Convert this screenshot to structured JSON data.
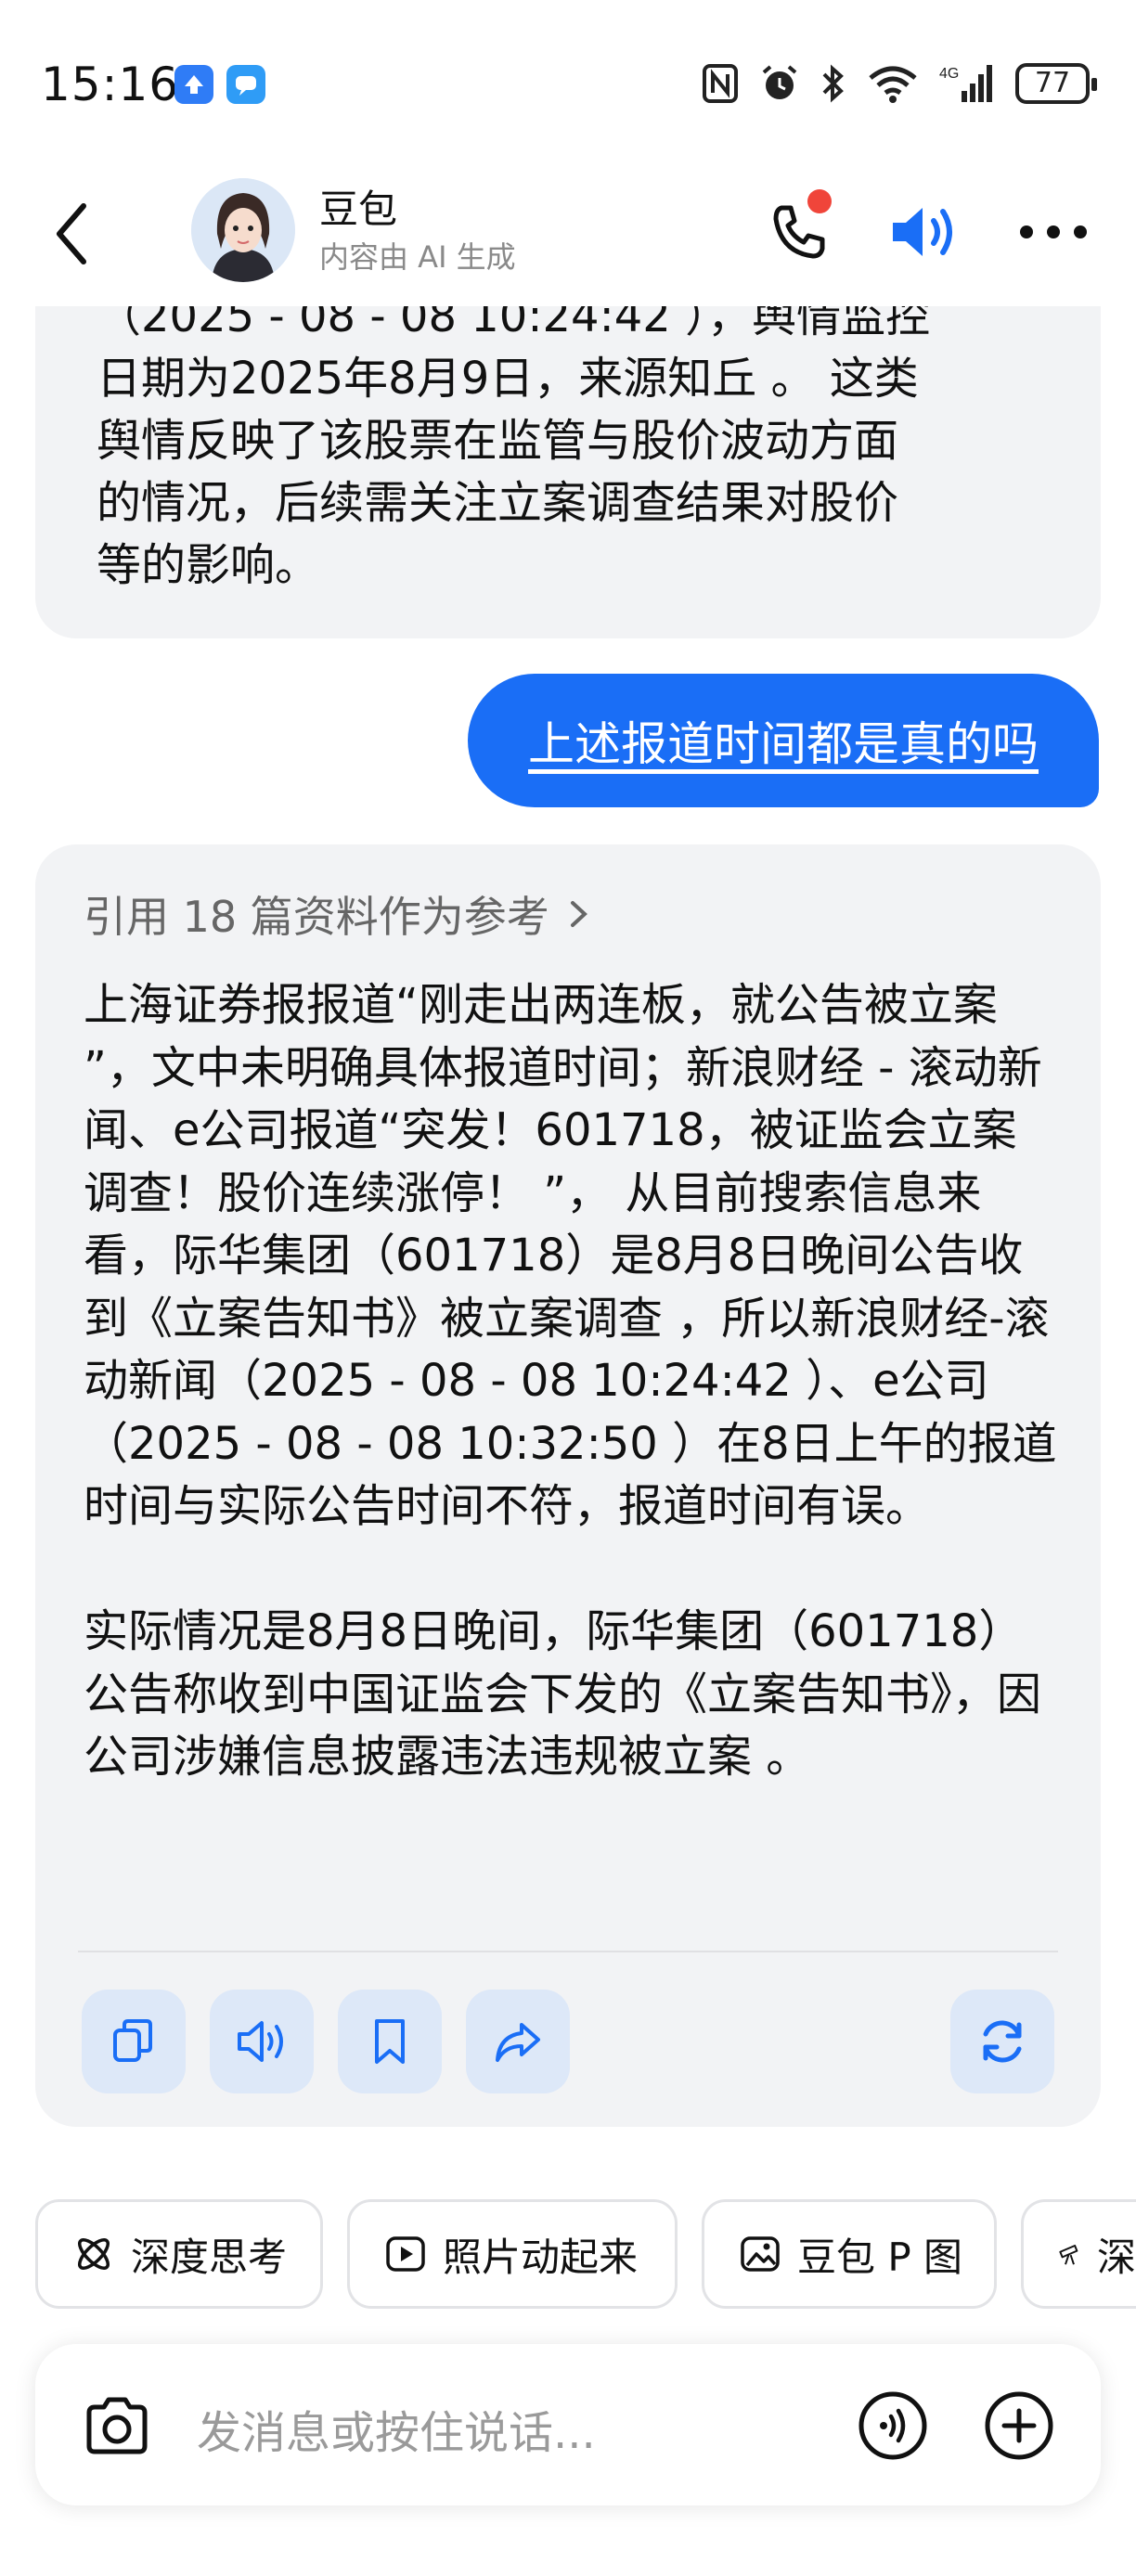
{
  "status_bar": {
    "time": "15:16",
    "battery": "77"
  },
  "header": {
    "bot_name": "豆包",
    "bot_subtitle": "内容由 AI 生成"
  },
  "previous_message": {
    "lines": [
      "（2025 - 08 - 08 10:24:42 ），舆情监控",
      "日期为2025年8月9日，来源知丘 。 这类",
      "舆情反映了该股票在监管与股价波动方面",
      "的情况，后续需关注立案调查结果对股价",
      "等的影响。"
    ]
  },
  "user_message": {
    "text": "上述报道时间都是真的吗"
  },
  "reply": {
    "references": "引用 18 篇资料作为参考",
    "paragraph_1": "上海证券报报道“刚走出两连板，就公告被立案 ”，文中未明确具体报道时间；新浪财经 - 滚动新闻、e公司报道“突发！601718，被证监会立案调查！股价连续涨停！ ”， 从目前搜索信息来看，际华集团（601718）是8月8日晚间公告收到《立案告知书》被立案调查 ，所以新浪财经-滚动新闻（2025 - 08 - 08 10:24:42 ）、e公司（2025 - 08 - 08 10:32:50 ）在8日上午的报道时间与实际公告时间不符，报道时间有误。",
    "paragraph_2": "实际情况是8月8日晚间，际华集团（601718）公告称收到中国证监会下发的《立案告知书》，因公司涉嫌信息披露违法违规被立案 。"
  },
  "chips": [
    {
      "label": "深度思考",
      "icon": "atom-icon"
    },
    {
      "label": "照片动起来",
      "icon": "play-icon"
    },
    {
      "label": "豆包 P 图",
      "icon": "image-edit-icon"
    },
    {
      "label": "深",
      "icon": "telescope-icon"
    }
  ],
  "input": {
    "placeholder": "发消息或按住说话..."
  },
  "colors": {
    "accent": "#1a6ef6",
    "card_bg": "#f2f3f5",
    "action_bg": "#dde8f8",
    "notification_dot": "#f0453a"
  }
}
